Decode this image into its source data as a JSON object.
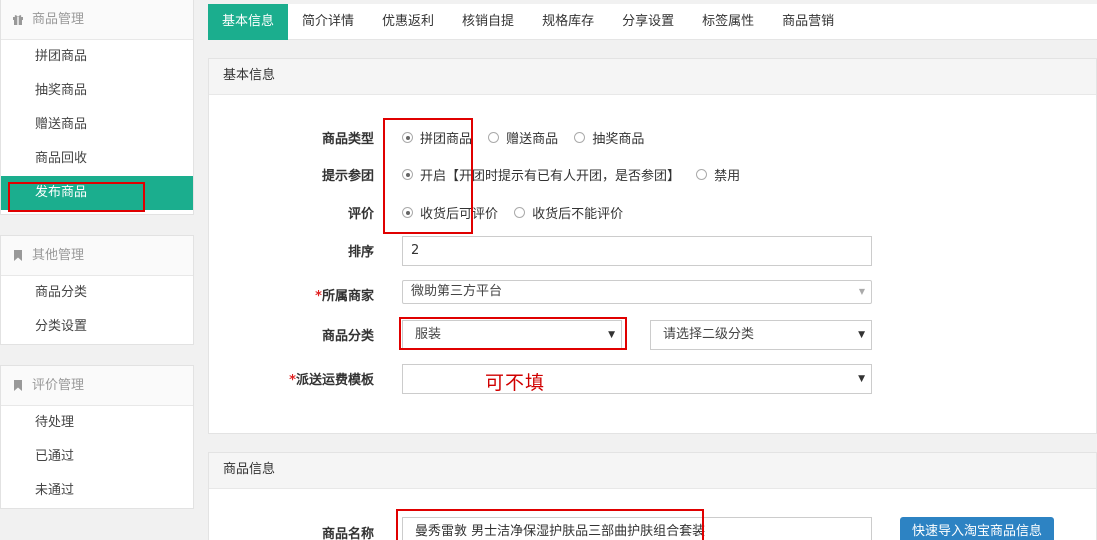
{
  "sidebar": {
    "groups": [
      {
        "title": "商品管理",
        "icon": "gift-icon",
        "items": [
          "拼团商品",
          "抽奖商品",
          "赠送商品",
          "商品回收",
          "发布商品"
        ]
      },
      {
        "title": "其他管理",
        "icon": "bookmark-icon",
        "items": [
          "商品分类",
          "分类设置"
        ]
      },
      {
        "title": "评价管理",
        "icon": "bookmark-icon",
        "items": [
          "待处理",
          "已通过",
          "未通过"
        ]
      }
    ]
  },
  "tabs": [
    "基本信息",
    "简介详情",
    "优惠返利",
    "核销自提",
    "规格库存",
    "分享设置",
    "标签属性",
    "商品营销"
  ],
  "basic": {
    "title": "基本信息",
    "type_label": "商品类型",
    "type_options": [
      "拼团商品",
      "赠送商品",
      "抽奖商品"
    ],
    "join_label": "提示参团",
    "join_options": [
      "开启【开团时提示有已有人开团，是否参团】",
      "禁用"
    ],
    "review_label": "评价",
    "review_options": [
      "收货后可评价",
      "收货后不能评价"
    ],
    "sort_label": "排序",
    "sort_value": "2",
    "merchant_label": "所属商家",
    "merchant_value": "微助第三方平台",
    "category_label": "商品分类",
    "category_value": "服装",
    "subcategory_placeholder": "请选择二级分类",
    "shipping_label": "派送运费模板",
    "shipping_value": "",
    "note": "可不填",
    "required_mark": "*"
  },
  "goods": {
    "title": "商品信息",
    "name_label": "商品名称",
    "name_value": "曼秀雷敦 男士洁净保湿护肤品三部曲护肤组合套装",
    "import_button": "快速导入淘宝商品信息"
  },
  "colors": {
    "accent": "#1bae8e",
    "highlight": "#e00000",
    "button": "#2d83c3"
  }
}
